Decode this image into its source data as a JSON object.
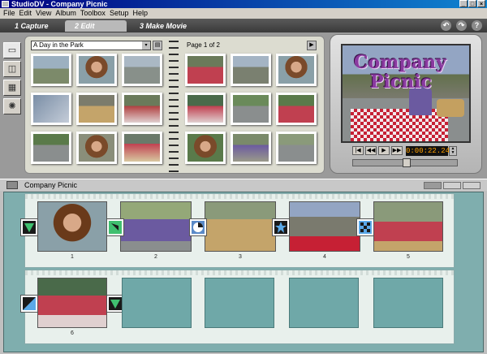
{
  "window": {
    "title": "StudioDV - Company Picnic",
    "controls": [
      "_",
      "□",
      "×"
    ]
  },
  "menu": [
    "File",
    "Edit",
    "View",
    "Album",
    "Toolbox",
    "Setup",
    "Help"
  ],
  "tabs": [
    {
      "label": "1 Capture"
    },
    {
      "label": "2 Edit"
    },
    {
      "label": "3 Make Movie"
    }
  ],
  "toolbar_icons": [
    "undo-icon",
    "redo-icon",
    "help-icon"
  ],
  "album": {
    "section": "A Day in the Park",
    "page": "Page 1 of 2",
    "dropdown_arrow": "▾",
    "next_arrow": "▶"
  },
  "player": {
    "overlay_line1": "Company",
    "overlay_line2": "Picnic",
    "timecode": "0:00:22.24",
    "buttons": [
      "|◀",
      "◀◀",
      "▶",
      "▶▶",
      "▶|"
    ]
  },
  "storyboard": {
    "title": "Company Picnic",
    "clips": [
      "1",
      "2",
      "3",
      "4",
      "5",
      "6"
    ]
  },
  "colors": {
    "accent": "#000080",
    "storyboard_bg": "#7faeae",
    "timecode": "#ffa000"
  }
}
